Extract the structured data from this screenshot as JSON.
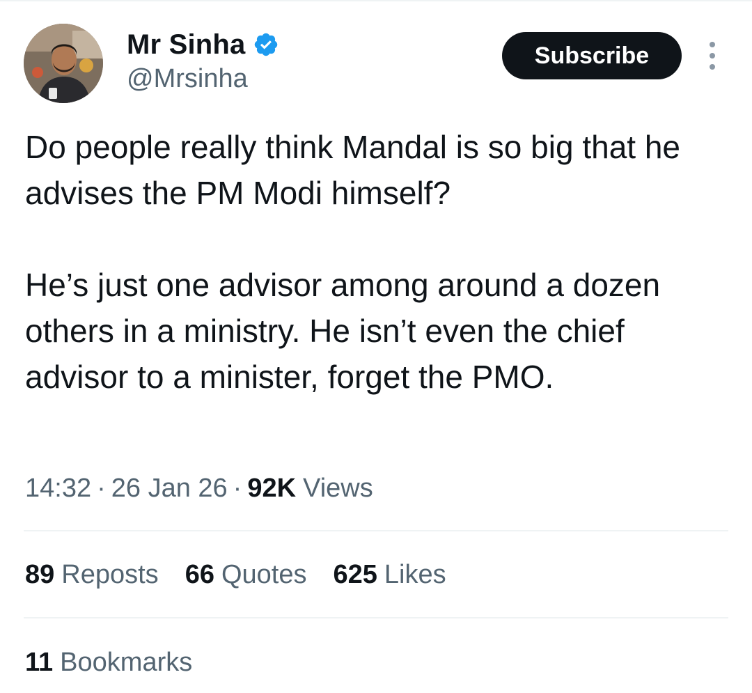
{
  "author": {
    "name": "Mr Sinha",
    "handle": "@Mrsinha",
    "verified_color": "#1d9bf0"
  },
  "actions": {
    "subscribe_label": "Subscribe",
    "more_icon": "more-vertical-icon"
  },
  "tweet": {
    "paragraph1": "Do people really think Mandal is so big that he advises the PM Modi himself?",
    "paragraph2": "He’s just one advisor among around a dozen others in a ministry. He isn’t even the chief advisor to a minister, forget the PMO."
  },
  "meta": {
    "time": "14:32",
    "date": "26 Jan 26",
    "views_count": "92K",
    "views_label": "Views"
  },
  "stats": {
    "reposts_count": "89",
    "reposts_label": "Reposts",
    "quotes_count": "66",
    "quotes_label": "Quotes",
    "likes_count": "625",
    "likes_label": "Likes",
    "bookmarks_count": "11",
    "bookmarks_label": "Bookmarks"
  },
  "colors": {
    "text_primary": "#0f1419",
    "text_secondary": "#536471",
    "divider": "#eff3f4"
  }
}
